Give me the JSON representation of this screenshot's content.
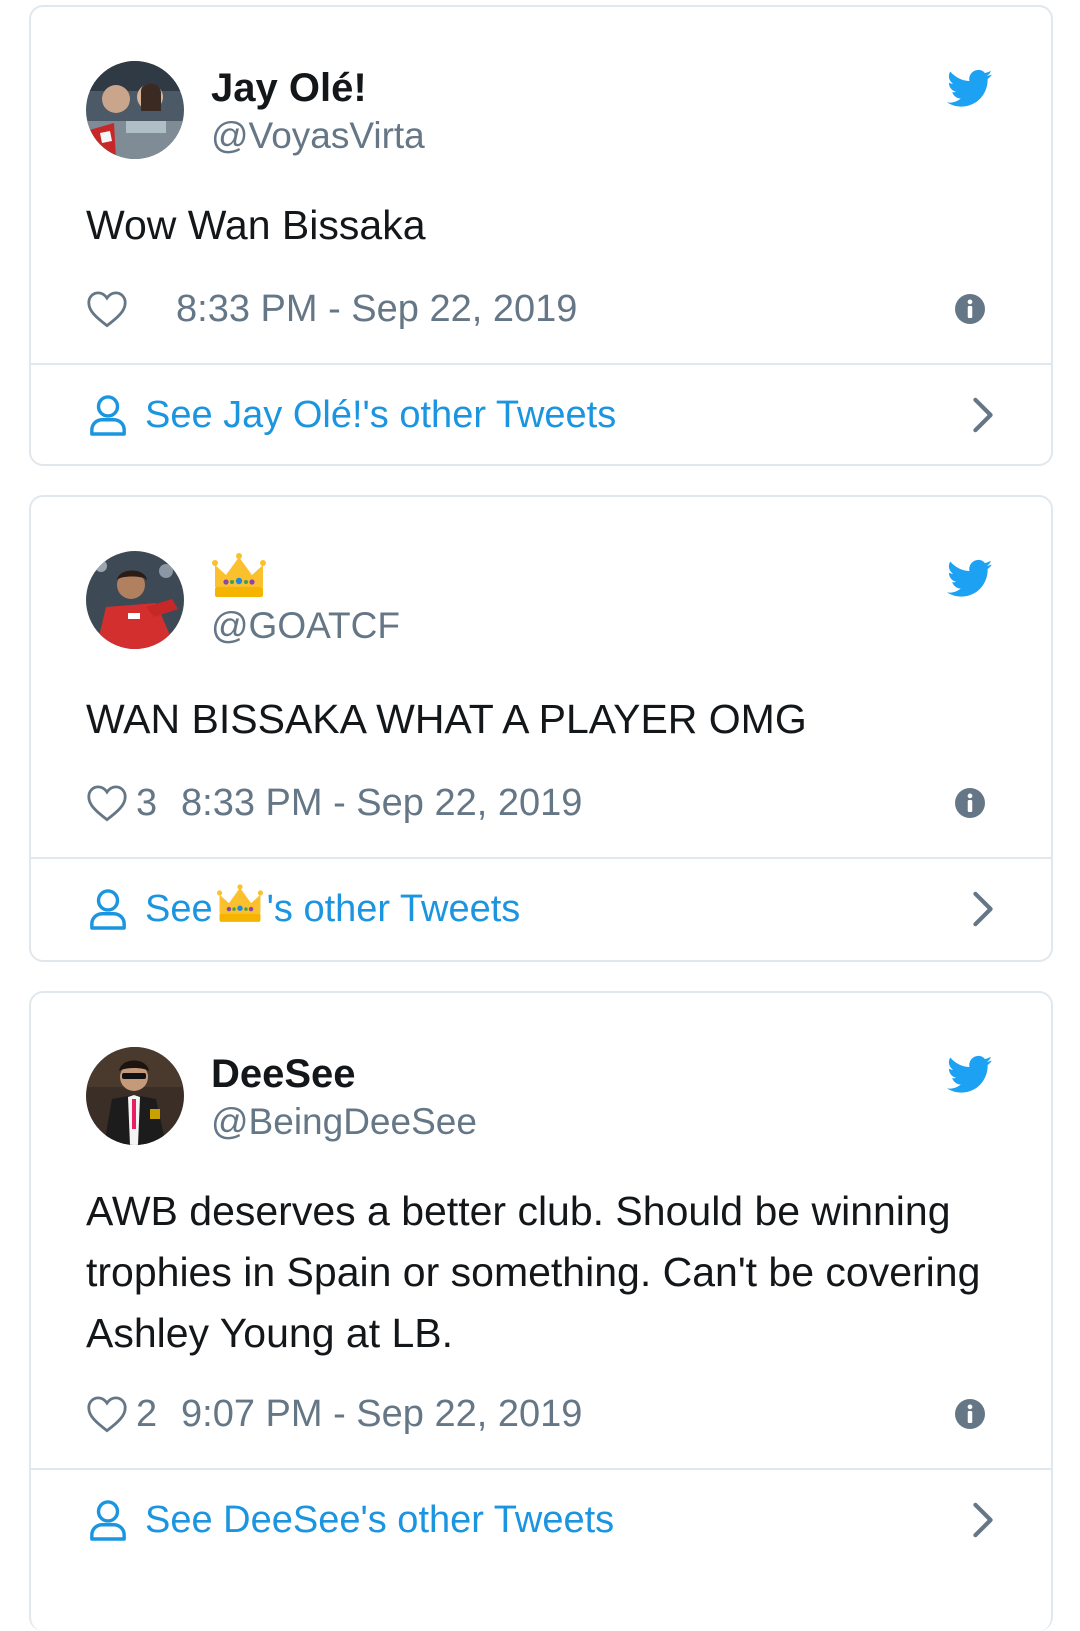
{
  "colors": {
    "link": "#1b95e0",
    "muted": "#657786",
    "text": "#14171a",
    "border": "#e1e8ed",
    "twitter_blue": "#1da1f2"
  },
  "tweets": [
    {
      "name": "Jay Olé!",
      "handle": "@VoyasVirta",
      "text": "Wow Wan Bissaka",
      "likes": "",
      "time": "8:33 PM - Sep 22, 2019",
      "footer_prefix": "See Jay Olé!'s other Tweets",
      "footer_suffix": ""
    },
    {
      "name_icon": "crown-emoji",
      "handle": "@GOATCF",
      "text": "WAN BISSAKA WHAT A PLAYER OMG",
      "likes": "3",
      "time": "8:33 PM - Sep 22, 2019",
      "footer_prefix": "See",
      "footer_suffix": "'s other Tweets"
    },
    {
      "name": "DeeSee",
      "handle": "@BeingDeeSee",
      "text": "AWB deserves a better club. Should be winning trophies in Spain or something. Can't be covering Ashley Young at LB.",
      "likes": "2",
      "time": "9:07 PM - Sep 22, 2019",
      "footer_prefix": "See DeeSee's other Tweets",
      "footer_suffix": ""
    }
  ]
}
